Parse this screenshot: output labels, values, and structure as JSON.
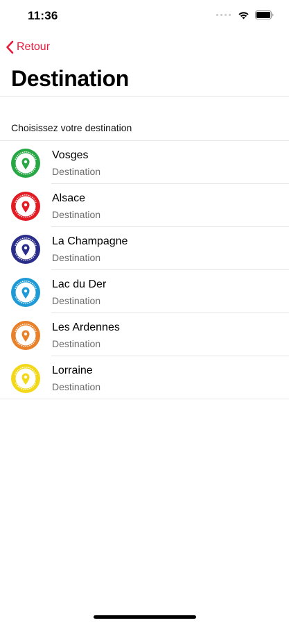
{
  "status_bar": {
    "time": "11:36"
  },
  "nav": {
    "back_label": "Retour"
  },
  "header": {
    "title": "Destination"
  },
  "section": {
    "header": "Choisissez votre destination"
  },
  "colors": {
    "accent": "#e8193c",
    "separator": "#e4e4e4",
    "subtitle": "#6a6a6a"
  },
  "destinations": [
    {
      "title": "Vosges",
      "subtitle": "Destination",
      "badge_color": "#27a844",
      "badge_text": "DESTINATION VOSGES",
      "icon": "location-pin-badge-icon"
    },
    {
      "title": "Alsace",
      "subtitle": "Destination",
      "badge_color": "#e31b23",
      "badge_text": "DESTINATION ALSACE",
      "icon": "location-pin-badge-icon"
    },
    {
      "title": "La Champagne",
      "subtitle": "Destination",
      "badge_color": "#2b2d8a",
      "badge_text": "DESTINATION LA CHAMPAGNE",
      "icon": "location-pin-badge-icon"
    },
    {
      "title": "Lac du Der",
      "subtitle": "Destination",
      "badge_color": "#1e9ad6",
      "badge_text": "DESTINATION LAC DU DER",
      "icon": "location-pin-badge-icon"
    },
    {
      "title": "Les Ardennes",
      "subtitle": "Destination",
      "badge_color": "#e8812a",
      "badge_text": "DESTINATION LES ARDENNES",
      "icon": "location-pin-badge-icon"
    },
    {
      "title": "Lorraine",
      "subtitle": "Destination",
      "badge_color": "#f3d81a",
      "badge_text": "DESTINATION LORRAINE",
      "icon": "location-pin-badge-icon"
    }
  ]
}
